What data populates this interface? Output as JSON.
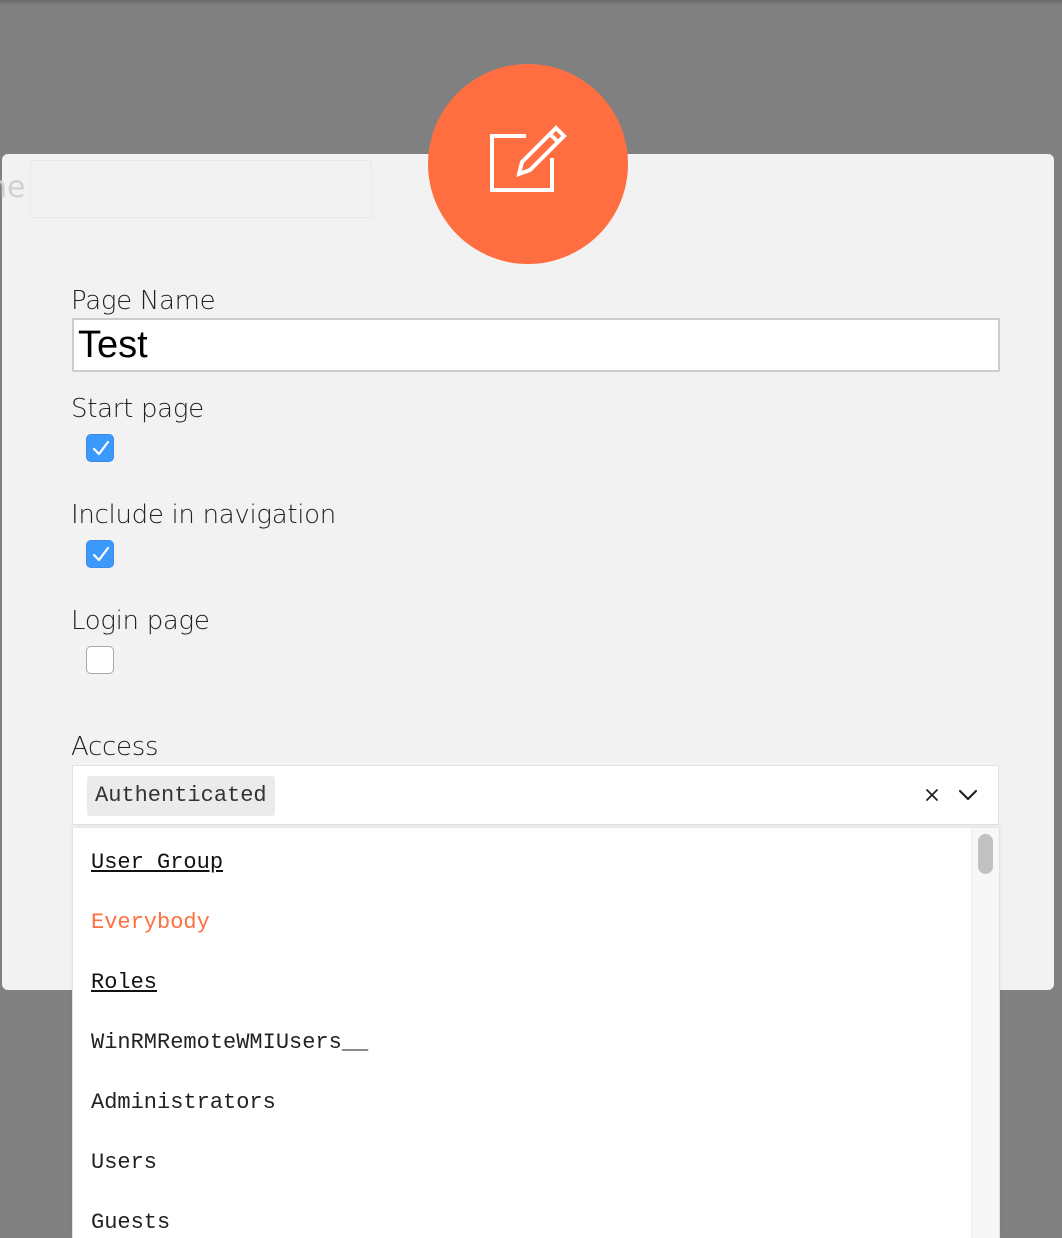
{
  "dialog": {
    "ghost_field_text": "ne",
    "header_icon": "edit-icon",
    "accent_color": "#ff6e40",
    "checkbox_color": "#3b99fc"
  },
  "form": {
    "page_name": {
      "label": "Page Name",
      "value": "Test"
    },
    "start_page": {
      "label": "Start page",
      "checked": true
    },
    "include_in_navigation": {
      "label": "Include in navigation",
      "checked": true
    },
    "login_page": {
      "label": "Login page",
      "checked": false
    },
    "access": {
      "label": "Access",
      "selected": "Authenticated",
      "clear_icon": "close-icon",
      "toggle_icon": "chevron-down-icon",
      "options": [
        {
          "label": "User Group",
          "type": "group"
        },
        {
          "label": "Everybody",
          "type": "highlighted"
        },
        {
          "label": "Roles",
          "type": "group"
        },
        {
          "label": "WinRMRemoteWMIUsers__",
          "type": "option"
        },
        {
          "label": "Administrators",
          "type": "option"
        },
        {
          "label": "Users",
          "type": "option"
        },
        {
          "label": "Guests",
          "type": "option"
        }
      ]
    }
  }
}
